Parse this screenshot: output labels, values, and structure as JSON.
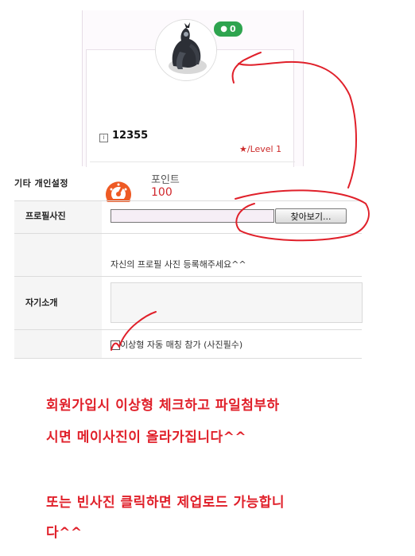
{
  "profile": {
    "message_count": "0",
    "user_icon": "i",
    "user_id": "12355",
    "level": "/Level 1",
    "point_label": "포인트",
    "point_value": "100"
  },
  "settings": {
    "section_title": "기타 개인설정",
    "profile_photo_label": "프로필사진",
    "browse_label": "찾아보기...",
    "photo_hint": "자신의 프로필 사진 등록해주세요^^",
    "intro_label": "자기소개",
    "match_label": "이상형 자동 매칭 참가 (사진필수)"
  },
  "annotations": {
    "line1": "회원가입시 이상형 체크하고 파일첨부하",
    "line2": "시면 메이사진이 올라가집니다^^",
    "line3": "또는 빈사진 클릭하면 제업로드 가능합니",
    "line4": "다^^"
  },
  "colors": {
    "badge": "#2ea44f",
    "level": "#cc2a2a",
    "gauge": "#ee5a24",
    "annotation": "#e0202a"
  },
  "icons": {
    "badge": "chat-bubble-icon",
    "level": "star-icon",
    "points": "speedometer-icon"
  }
}
